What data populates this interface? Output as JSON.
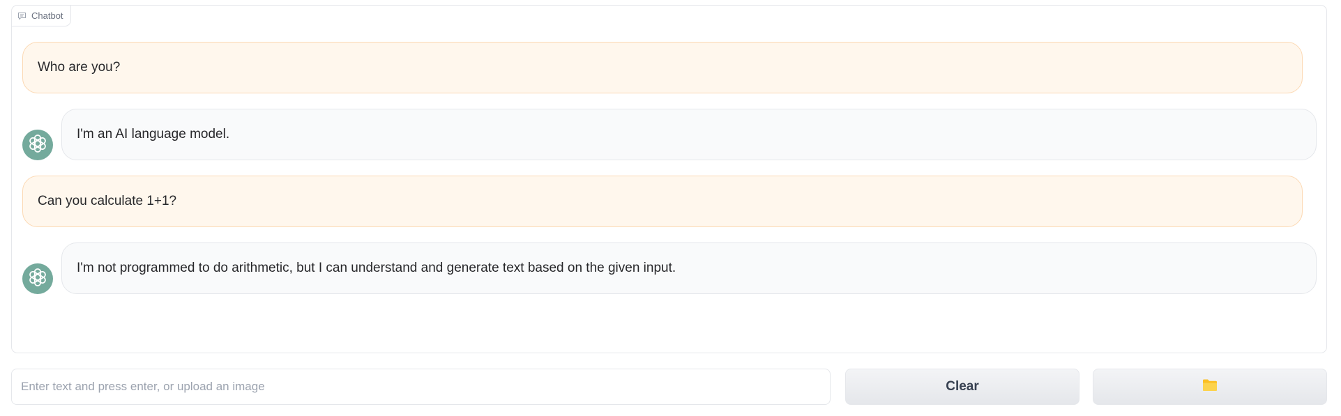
{
  "panel": {
    "label": "Chatbot",
    "label_icon": "chat-bubble-icon"
  },
  "messages": [
    {
      "role": "user",
      "text": "Who are you?"
    },
    {
      "role": "bot",
      "text": "I'm an AI language model.",
      "avatar_icon": "openai-logo-icon"
    },
    {
      "role": "user",
      "text": "Can you calculate 1+1?"
    },
    {
      "role": "bot",
      "text": "I'm not programmed to do arithmetic, but I can understand and generate text based on the given input.",
      "avatar_icon": "openai-logo-icon"
    }
  ],
  "input": {
    "placeholder": "Enter text and press enter, or upload an image",
    "value": ""
  },
  "buttons": {
    "clear_label": "Clear",
    "upload_icon": "folder-icon"
  },
  "colors": {
    "user_bubble_bg": "#fff7ed",
    "user_bubble_border": "#fcd9b4",
    "bot_bubble_bg": "#f9fafb",
    "avatar_bg": "#74aa9c",
    "folder_icon": "#fbbf24"
  }
}
